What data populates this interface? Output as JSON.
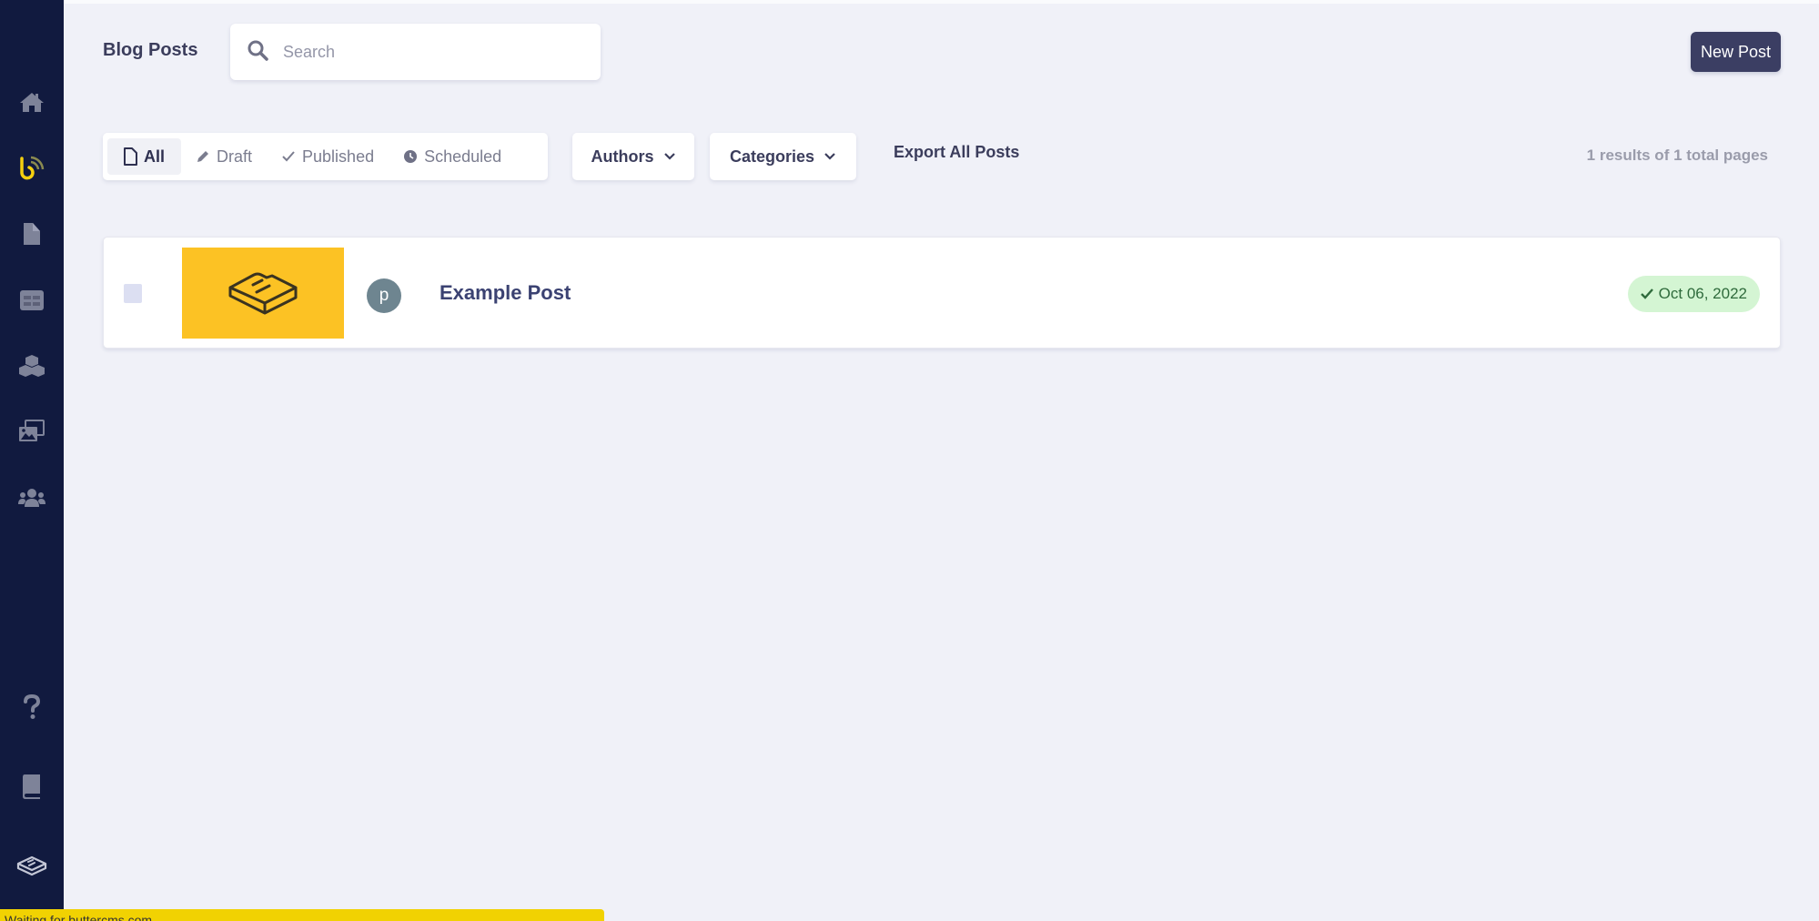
{
  "header": {
    "title": "Blog Posts",
    "search": {
      "placeholder": "Search",
      "value": ""
    },
    "new_post_label": "New Post"
  },
  "sidebar": {
    "items": [
      {
        "name": "home",
        "icon": "home-icon"
      },
      {
        "name": "blog",
        "icon": "buttercms-blog-icon",
        "active": true
      },
      {
        "name": "pages",
        "icon": "page-icon"
      },
      {
        "name": "collections",
        "icon": "table-icon"
      },
      {
        "name": "components",
        "icon": "cubes-icon"
      },
      {
        "name": "media",
        "icon": "media-library-icon"
      },
      {
        "name": "users",
        "icon": "users-icon"
      }
    ],
    "bottom_items": [
      {
        "name": "help",
        "icon": "question-icon"
      },
      {
        "name": "docs",
        "icon": "book-icon"
      },
      {
        "name": "butter-logo",
        "icon": "butter-logo-icon"
      }
    ]
  },
  "filters": {
    "tabs": [
      {
        "label": "All",
        "icon": "file-icon",
        "active": true
      },
      {
        "label": "Draft",
        "icon": "pencil-icon"
      },
      {
        "label": "Published",
        "icon": "check-icon"
      },
      {
        "label": "Scheduled",
        "icon": "clock-icon"
      }
    ],
    "authors_label": "Authors",
    "categories_label": "Categories",
    "export_label": "Export All Posts",
    "results_text": "1 results of 1 total pages"
  },
  "posts": [
    {
      "title": "Example Post",
      "author_initial": "p",
      "date": "Oct 06, 2022",
      "status": "published",
      "checked": false
    }
  ],
  "colors": {
    "sidebar_bg": "#111a3f",
    "accent_yellow": "#fcc224",
    "primary_button": "#3b3e63",
    "published_badge_bg": "#d4f5d3",
    "published_badge_text": "#2f6b3c"
  },
  "status_bar": {
    "text": "Waiting for buttercms.com..."
  }
}
